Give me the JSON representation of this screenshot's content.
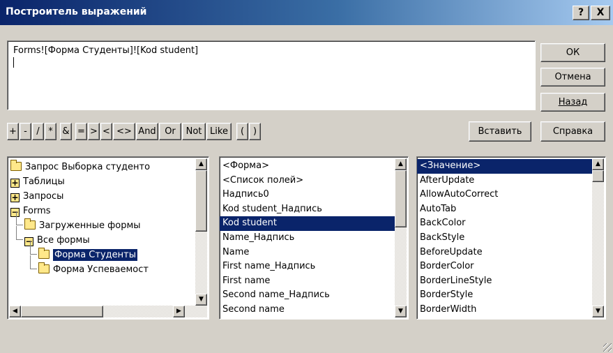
{
  "window": {
    "title": "Построитель выражений",
    "help_label": "?",
    "close_label": "X"
  },
  "expression": {
    "value": "Forms![Форма Студенты]![Kod student]"
  },
  "buttons": {
    "ok": "ОК",
    "cancel": "Отмена",
    "back": "Назад",
    "help": "Справка",
    "paste": "Вставить"
  },
  "operators": [
    "+",
    "-",
    "/",
    "*",
    "&",
    "=",
    ">",
    "<",
    "<>",
    "And",
    "Or",
    "Not",
    "Like",
    "(",
    ")"
  ],
  "tree": [
    {
      "label": "Запрос Выборка студенто",
      "icon": "folder-icon"
    },
    {
      "label": "Таблицы",
      "icon": "expand-icon"
    },
    {
      "label": "Запросы",
      "icon": "expand-icon"
    },
    {
      "label": "Forms",
      "icon": "collapse-icon"
    },
    {
      "label": "Загруженные формы",
      "icon": "folder-icon"
    },
    {
      "label": "Все формы",
      "icon": "collapse-icon"
    },
    {
      "label": "Форма Студенты",
      "icon": "open-folder-icon",
      "selected": true
    },
    {
      "label": "Форма Успеваемост",
      "icon": "folder-icon"
    }
  ],
  "fields": [
    "<Форма>",
    "<Список полей>",
    "Надпись0",
    "Kod student_Надпись",
    "Kod student",
    "Name_Надпись",
    "Name",
    "First name_Надпись",
    "First name",
    "Second name_Надпись",
    "Second name"
  ],
  "fields_selected": 4,
  "properties": [
    "<Значение>",
    "AfterUpdate",
    "AllowAutoCorrect",
    "AutoTab",
    "BackColor",
    "BackStyle",
    "BeforeUpdate",
    "BorderColor",
    "BorderLineStyle",
    "BorderStyle",
    "BorderWidth"
  ],
  "properties_selected": 0,
  "colors": {
    "title_start": "#0a246a",
    "title_end": "#a6caf0",
    "selection": "#0a246a",
    "face": "#d4d0c8"
  }
}
